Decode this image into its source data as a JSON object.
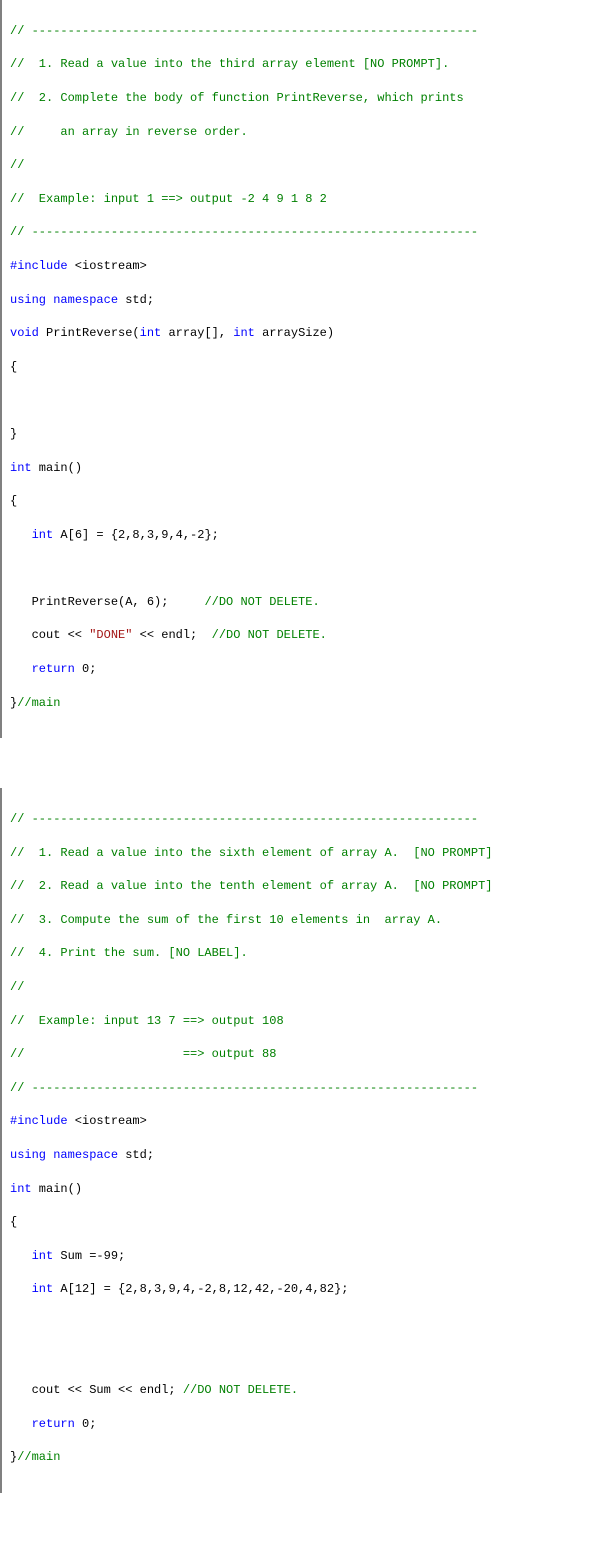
{
  "block1": {
    "l1": "// --------------------------------------------------------------",
    "l2": "//  1. Read a value into the third array element [NO PROMPT].",
    "l3": "//  2. Complete the body of function PrintReverse, which prints",
    "l4": "//     an array in reverse order.",
    "l5": "//",
    "l6": "//  Example: input 1 ==> output -2 4 9 1 8 2",
    "l7": "// --------------------------------------------------------------",
    "l8a": "#include",
    "l8b": " <iostream>",
    "l9a": "using",
    "l9b": " ",
    "l9c": "namespace",
    "l9d": " std;",
    "l10a": "void",
    "l10b": " PrintReverse(",
    "l10c": "int",
    "l10d": " array[], ",
    "l10e": "int",
    "l10f": " arraySize)",
    "l11": "{",
    "l12": "",
    "l13": "",
    "l14": "}",
    "l15a": "int",
    "l15b": " main()",
    "l16": "{",
    "l17a": "   ",
    "l17b": "int",
    "l17c": " A[6] = {2,8,3,9,4,-2};",
    "l18": "",
    "l19": "",
    "l20a": "   PrintReverse(A, 6);     ",
    "l20b": "//DO NOT DELETE.",
    "l21a": "   cout << ",
    "l21b": "\"DONE\"",
    "l21c": " << endl;  ",
    "l21d": "//DO NOT DELETE.",
    "l22a": "   ",
    "l22b": "return",
    "l22c": " 0;",
    "l23a": "}",
    "l23b": "//main"
  },
  "block2": {
    "l1": "// --------------------------------------------------------------",
    "l2": "//  1. Read a value into the sixth element of array A.  [NO PROMPT]",
    "l3": "//  2. Read a value into the tenth element of array A.  [NO PROMPT]",
    "l4": "//  3. Compute the sum of the first 10 elements in  array A.",
    "l5": "//  4. Print the sum. [NO LABEL].",
    "l6": "//",
    "l7": "//  Example: input 13 7 ==> output 108",
    "l8": "//                      ==> output 88",
    "l9": "// --------------------------------------------------------------",
    "l10a": "#include",
    "l10b": " <iostream>",
    "l11a": "using",
    "l11b": " ",
    "l11c": "namespace",
    "l11d": " std;",
    "l12a": "int",
    "l12b": " main()",
    "l13": "{",
    "l14a": "   ",
    "l14b": "int",
    "l14c": " Sum =-99;",
    "l15a": "   ",
    "l15b": "int",
    "l15c": " A[12] = {2,8,3,9,4,-2,8,12,42,-20,4,82};",
    "l16": "",
    "l17": "",
    "l18": "",
    "l19": "",
    "l20a": "   cout << Sum << endl; ",
    "l20b": "//DO NOT DELETE.",
    "l21a": "   ",
    "l21b": "return",
    "l21c": " 0;",
    "l22a": "}",
    "l22b": "//main"
  }
}
